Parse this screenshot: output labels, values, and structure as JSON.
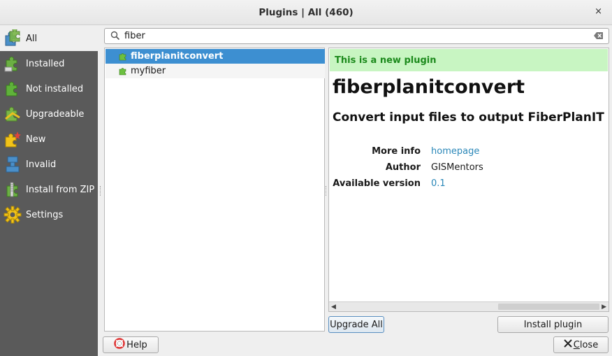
{
  "window": {
    "title": "Plugins | All (460)",
    "close_glyph": "×"
  },
  "sidebar": {
    "items": [
      {
        "label": "All",
        "icon": "all-plugins-icon"
      },
      {
        "label": "Installed",
        "icon": "installed-plugins-icon"
      },
      {
        "label": "Not installed",
        "icon": "not-installed-plugins-icon"
      },
      {
        "label": "Upgradeable",
        "icon": "upgradeable-plugins-icon"
      },
      {
        "label": "New",
        "icon": "new-plugins-icon"
      },
      {
        "label": "Invalid",
        "icon": "invalid-plugins-icon"
      },
      {
        "label": "Install from ZIP",
        "icon": "install-zip-icon"
      },
      {
        "label": "Settings",
        "icon": "settings-gear-icon"
      }
    ],
    "active_index": 0
  },
  "search": {
    "value": "fiber",
    "placeholder": ""
  },
  "plugin_list": {
    "items": [
      {
        "name": "fiberplanitconvert",
        "selected": true
      },
      {
        "name": "myfiber",
        "selected": false
      }
    ]
  },
  "details": {
    "banner": "This is a new plugin",
    "name": "fiberplanitconvert",
    "description": "Convert input files to output FiberPlanIT sha",
    "fields": [
      {
        "key": "More info",
        "value": "homepage",
        "link": true
      },
      {
        "key": "Author",
        "value": "GISMentors",
        "link": false
      },
      {
        "key": "Available version",
        "value": "0.1",
        "link": true
      }
    ]
  },
  "buttons": {
    "upgrade_all": "Upgrade All",
    "install_plugin": "Install plugin",
    "help": "Help",
    "close_prefix": "C",
    "close_rest": "lose"
  },
  "colors": {
    "sidebar_bg": "#5a5a5a",
    "selection": "#3d8fd1",
    "new_banner_bg": "#c8f5c2",
    "new_banner_text": "#1c8a1c",
    "link": "#2a87b8"
  }
}
